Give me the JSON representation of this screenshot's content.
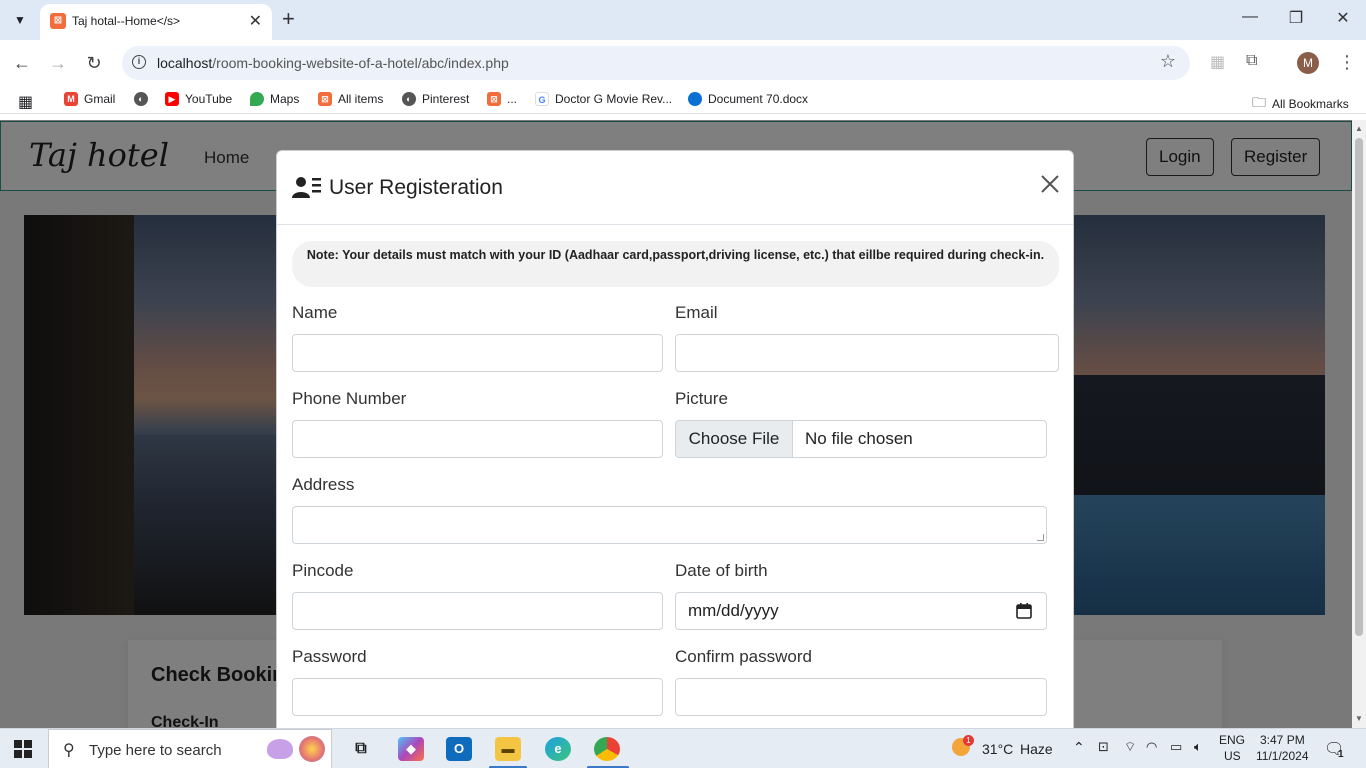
{
  "browser": {
    "tab_title": "Taj hotal--Home</s>",
    "url_host": "localhost",
    "url_path": "/room-booking-website-of-a-hotel/abc/index.php",
    "profile_initial": "M",
    "bookmarks": [
      "Gmail",
      "YouTube",
      "Maps",
      "All items",
      "Pinterest",
      "...",
      "Doctor G Movie Rev...",
      "Document 70.docx"
    ],
    "all_bookmarks": "All Bookmarks"
  },
  "site": {
    "brand": "Taj hotel",
    "nav_home": "Home",
    "login": "Login",
    "register": "Register",
    "check_title": "Check Booking Availability",
    "check_in": "Check-In"
  },
  "modal": {
    "title": "User Registeration",
    "note": "Note: Your details must match with your ID (Aadhaar card,passport,driving license, etc.) that eillbe required during check-in.",
    "labels": {
      "name": "Name",
      "email": "Email",
      "phone": "Phone Number",
      "picture": "Picture",
      "address": "Address",
      "pincode": "Pincode",
      "dob": "Date of birth",
      "password": "Password",
      "confirm_password": "Confirm password"
    },
    "file_button": "Choose File",
    "file_status": "No file chosen",
    "date_placeholder": "mm/dd/yyyy"
  },
  "taskbar": {
    "search_placeholder": "Type here to search",
    "weather_temp": "31°C",
    "weather_desc": "Haze",
    "weather_badge": "1",
    "lang_1": "ENG",
    "lang_2": "US",
    "time": "3:47 PM",
    "date": "11/1/2024",
    "notification_count": "1"
  },
  "colors": {
    "nav_border": "#2e9c94",
    "accent_blue": "#3a78c8",
    "tab_strip": "#dfe8f5"
  }
}
